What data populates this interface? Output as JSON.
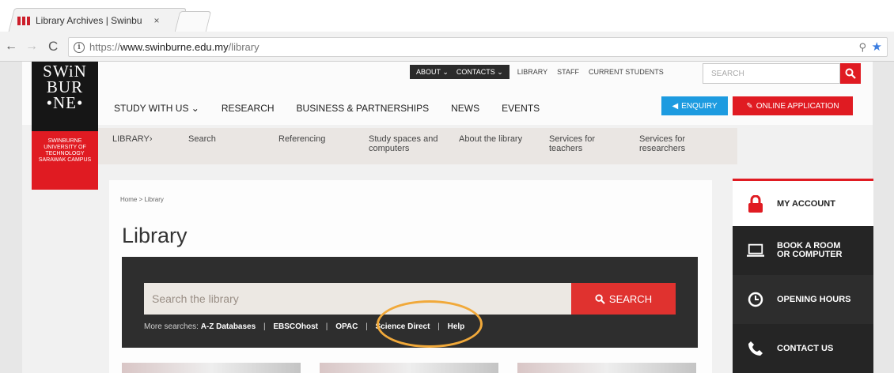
{
  "browser": {
    "tab_title": "Library Archives | Swinbu",
    "tab_close": "×",
    "url_scheme": "https://",
    "url_host": "www.swinburne.edu.my",
    "url_path": "/library"
  },
  "logo": {
    "lines": [
      "SWiN",
      "BUR",
      "•NE•"
    ],
    "sub_lines": [
      "Swinburne",
      "University of",
      "Technology",
      "Sarawak Campus"
    ]
  },
  "utility_nav": {
    "dark_items": [
      "ABOUT ⌄",
      "CONTACTS ⌄"
    ],
    "light_items": [
      "LIBRARY",
      "STAFF",
      "CURRENT STUDENTS"
    ]
  },
  "site_search": {
    "placeholder": "SEARCH"
  },
  "main_nav": [
    "STUDY WITH US ⌄",
    "RESEARCH",
    "BUSINESS & PARTNERSHIPS",
    "NEWS",
    "EVENTS"
  ],
  "cta": {
    "enquiry": "ENQUIRY",
    "apply": "ONLINE APPLICATION"
  },
  "subnav": [
    "LIBRARY›",
    "Search",
    "Referencing",
    "Study spaces and computers",
    "About the library",
    "Services for teachers",
    "Services for researchers"
  ],
  "breadcrumb": "Home > Library",
  "page_title": "Library",
  "library_search": {
    "placeholder": "Search the library",
    "button": "SEARCH",
    "more_label": "More searches:",
    "links": [
      "A-Z Databases",
      "EBSCOhost",
      "OPAC",
      "Science Direct",
      "Help"
    ]
  },
  "sidebar": {
    "account": "MY ACCOUNT",
    "book_line1": "BOOK A ROOM",
    "book_line2": "OR COMPUTER",
    "hours": "OPENING HOURS",
    "contact": "CONTACT US"
  },
  "colors": {
    "brand_red": "#e01b22",
    "enquiry_blue": "#1d9be0",
    "highlight": "#f1a93a"
  }
}
